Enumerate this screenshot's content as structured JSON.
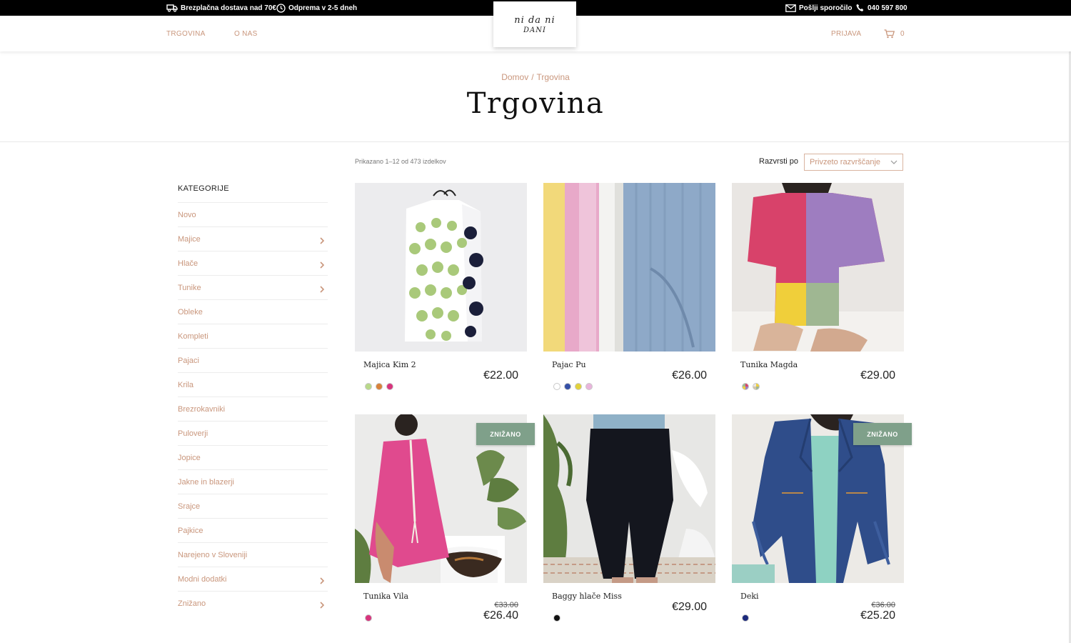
{
  "topbar": {
    "shipping": "Brezplačna dostava nad 70€",
    "dispatch": "Odprema v 2-5 dneh",
    "message": "Pošlji sporočilo",
    "phone": "040 597 800"
  },
  "header": {
    "nav": [
      "TRGOVINA",
      "O NAS"
    ],
    "logo_line1": "ni da ni",
    "logo_line2": "DANI",
    "login": "PRIJAVA",
    "cart_count": "0"
  },
  "breadcrumb": {
    "home": "Domov",
    "separator": "/",
    "current": "Trgovina"
  },
  "page_title": "Trgovina",
  "toolbar": {
    "result_count": "Prikazano 1–12 od 473 izdelkov",
    "sort_label": "Razvrsti po",
    "sort_value": "Privzeto razvrščanje"
  },
  "sidebar": {
    "title": "KATEGORIJE",
    "items": [
      {
        "label": "Novo",
        "has_children": false
      },
      {
        "label": "Majice",
        "has_children": true
      },
      {
        "label": "Hlače",
        "has_children": true
      },
      {
        "label": "Tunike",
        "has_children": true
      },
      {
        "label": "Obleke",
        "has_children": false
      },
      {
        "label": "Kompleti",
        "has_children": false
      },
      {
        "label": "Pajaci",
        "has_children": false
      },
      {
        "label": "Krila",
        "has_children": false
      },
      {
        "label": "Brezrokavniki",
        "has_children": false
      },
      {
        "label": "Puloverji",
        "has_children": false
      },
      {
        "label": "Jopice",
        "has_children": false
      },
      {
        "label": "Jakne in blazerji",
        "has_children": false
      },
      {
        "label": "Srajce",
        "has_children": false
      },
      {
        "label": "Pajkice",
        "has_children": false
      },
      {
        "label": "Narejeno v Sloveniji",
        "has_children": false
      },
      {
        "label": "Modni dodatki",
        "has_children": true
      },
      {
        "label": "Znižano",
        "has_children": true
      }
    ]
  },
  "products": [
    {
      "name": "Majica Kim 2",
      "price": "€22.00",
      "old_price": "",
      "badge": "",
      "swatches": [
        "#b9d98a",
        "#d9823a",
        "#d8347d"
      ]
    },
    {
      "name": "Pajac Pu",
      "price": "€26.00",
      "old_price": "",
      "badge": "",
      "swatches": [
        "#ffffff",
        "#3550a6",
        "#e2d23c",
        "#e9b4dc"
      ]
    },
    {
      "name": "Tunika Magda",
      "price": "€29.00",
      "old_price": "",
      "badge": "",
      "swatches": [
        "multi-pink",
        "multi-yellow"
      ]
    },
    {
      "name": "Tunika Vila",
      "price": "€26.40",
      "old_price": "€33.00",
      "badge": "ZNIŽANO",
      "swatches": [
        "#d8347d"
      ]
    },
    {
      "name": "Baggy hlače Miss",
      "price": "€29.00",
      "old_price": "",
      "badge": "",
      "swatches": [
        "#111111"
      ]
    },
    {
      "name": "Deki",
      "price": "€25.20",
      "old_price": "€36.00",
      "badge": "ZNIŽANO",
      "swatches": [
        "#1c2a7c"
      ]
    }
  ],
  "colors": {
    "accent": "#c9967c",
    "badge": "#7fa08a",
    "topbar": "#000000"
  }
}
